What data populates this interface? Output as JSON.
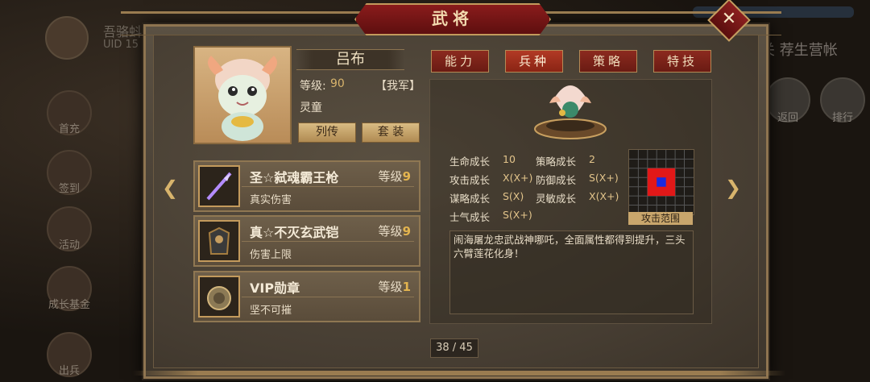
{
  "background": {
    "player_name": "吾骆蚪",
    "player_uid": "UID 15",
    "left_buttons": [
      "首充",
      "签到",
      "活动",
      "成长基金",
      "出兵"
    ],
    "right_text": "关 荐生营帐",
    "right_buttons": [
      "返回",
      "排行"
    ]
  },
  "dialog": {
    "title": "武将",
    "close_icon": "close-x-icon",
    "colors": {
      "accent": "#8a1c1c",
      "gold": "#d8b46c",
      "frame": "#8e7450"
    }
  },
  "hero": {
    "name": "吕布",
    "level_label": "等级:",
    "level_value": "90",
    "faction": "【我军】",
    "type": "灵童",
    "btn_biography": "列传",
    "btn_suit": "套 装"
  },
  "equipment": [
    {
      "name": "圣☆弑魂霸王枪",
      "level_label": "等级",
      "level": "9",
      "desc": "真实伤害",
      "icon": "spear-icon"
    },
    {
      "name": "真☆不灭玄武铠",
      "level_label": "等级",
      "level": "9",
      "desc": "伤害上限",
      "icon": "armor-icon"
    },
    {
      "name": "VIP勋章",
      "level_label": "等级",
      "level": "1",
      "desc": "坚不可摧",
      "icon": "medal-icon"
    }
  ],
  "tabs": [
    {
      "label": "能力",
      "active": false
    },
    {
      "label": "兵种",
      "active": true
    },
    {
      "label": "策略",
      "active": false
    },
    {
      "label": "特技",
      "active": false
    }
  ],
  "stats": [
    {
      "label": "生命成长",
      "value": "10"
    },
    {
      "label": "策略成长",
      "value": "2"
    },
    {
      "label": "攻击成长",
      "value": "X(X+)"
    },
    {
      "label": "防御成长",
      "value": "S(X+)"
    },
    {
      "label": "谋略成长",
      "value": "S(X)"
    },
    {
      "label": "灵敏成长",
      "value": "X(X+)"
    },
    {
      "label": "士气成长",
      "value": "S(X+)"
    }
  ],
  "attack_range_label": "攻击范围",
  "description": "闹海屠龙忠武战神哪吒，全面属性都得到提升，三头六臂莲花化身！",
  "pager": "38 / 45"
}
